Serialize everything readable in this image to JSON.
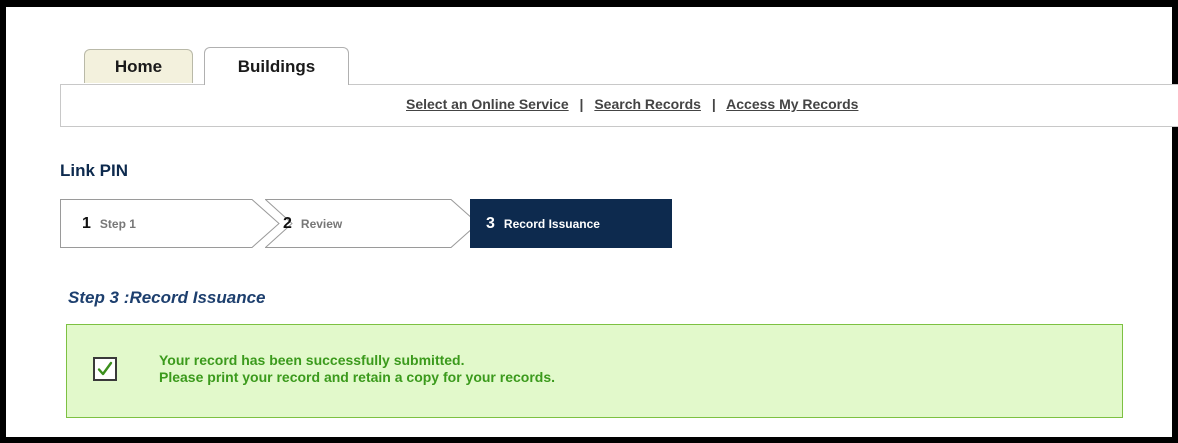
{
  "tabs": [
    {
      "label": "Home",
      "active": false
    },
    {
      "label": "Buildings",
      "active": true
    }
  ],
  "nav_links": [
    {
      "label": "Select an Online Service"
    },
    {
      "label": "Search Records"
    },
    {
      "label": "Access My Records"
    }
  ],
  "nav_separator": "|",
  "page_title": "Link PIN",
  "steps": [
    {
      "number": "1",
      "label": "Step 1",
      "state": "done"
    },
    {
      "number": "2",
      "label": "Review",
      "state": "done"
    },
    {
      "number": "3",
      "label": "Record Issuance",
      "state": "current"
    }
  ],
  "step_heading": {
    "prefix": "Step 3",
    "separator": ":",
    "title": "Record Issuance"
  },
  "message": {
    "line1": "Your record has been successfully submitted.",
    "line2": "Please print your record and retain a copy for your records.",
    "icon": "checkbox-checked-icon"
  },
  "colors": {
    "active_step": "#0d2a4e",
    "success_bg": "#e2f9cb",
    "success_border": "#7dc142",
    "success_text": "#3b9a1c",
    "heading": "#1d3f6e",
    "home_tab": "#f3f1dd"
  }
}
